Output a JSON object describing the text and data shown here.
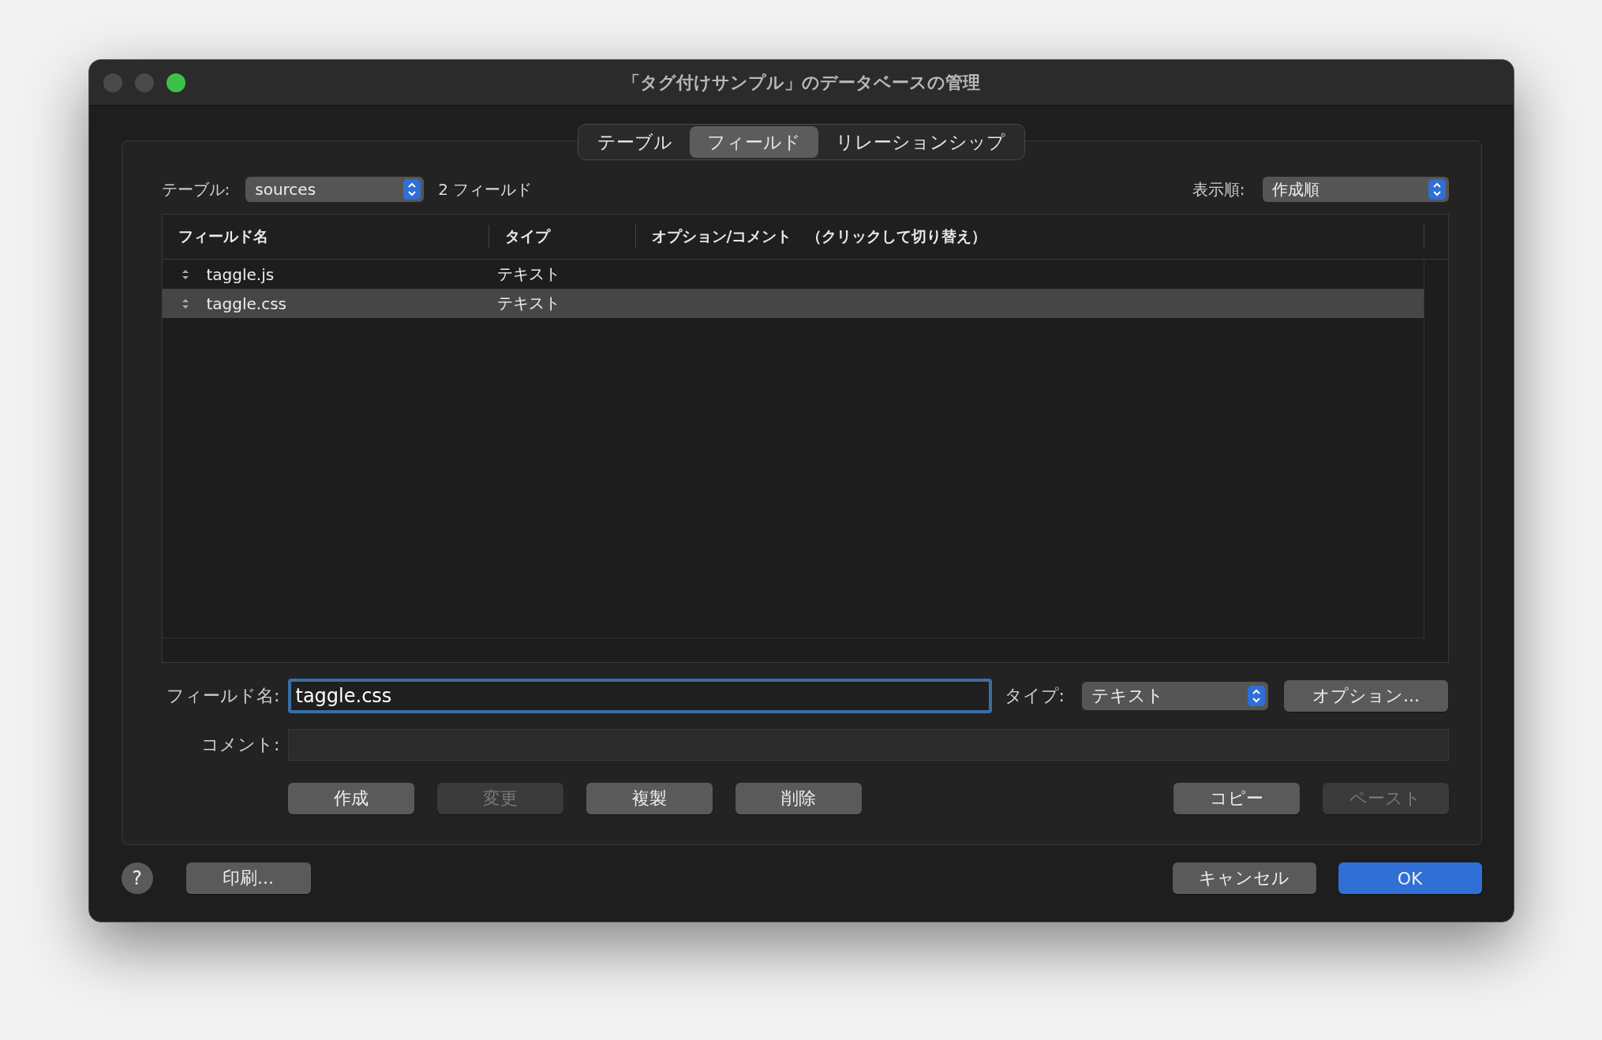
{
  "window": {
    "title": "「タグ付けサンプル」のデータベースの管理"
  },
  "tabs": [
    {
      "label": "テーブル",
      "selected": false
    },
    {
      "label": "フィールド",
      "selected": true
    },
    {
      "label": "リレーションシップ",
      "selected": false
    }
  ],
  "table_picker": {
    "label": "テーブル:",
    "value": "sources",
    "count": "2 フィールド"
  },
  "sort_picker": {
    "label": "表示順:",
    "value": "作成順"
  },
  "table": {
    "columns": [
      "フィールド名",
      "タイプ",
      "オプション/コメント　（クリックして切り替え）"
    ],
    "rows": [
      {
        "name": "taggle.js",
        "type": "テキスト",
        "selected": false
      },
      {
        "name": "taggle.css",
        "type": "テキスト",
        "selected": true
      }
    ]
  },
  "field_name": {
    "label": "フィールド名:",
    "value": "taggle.css"
  },
  "field_type": {
    "label": "タイプ:",
    "value": "テキスト"
  },
  "options_button": "オプション...",
  "comment": {
    "label": "コメント:"
  },
  "actions": [
    {
      "label": "作成",
      "disabled": false
    },
    {
      "label": "変更",
      "disabled": true
    },
    {
      "label": "複製",
      "disabled": false
    },
    {
      "label": "削除",
      "disabled": false
    }
  ],
  "clipboard": [
    {
      "label": "コピー",
      "disabled": false
    },
    {
      "label": "ペースト",
      "disabled": true
    }
  ],
  "help": "?",
  "print_button": "印刷...",
  "cancel_button": "キャンセル",
  "ok_button": "OK"
}
